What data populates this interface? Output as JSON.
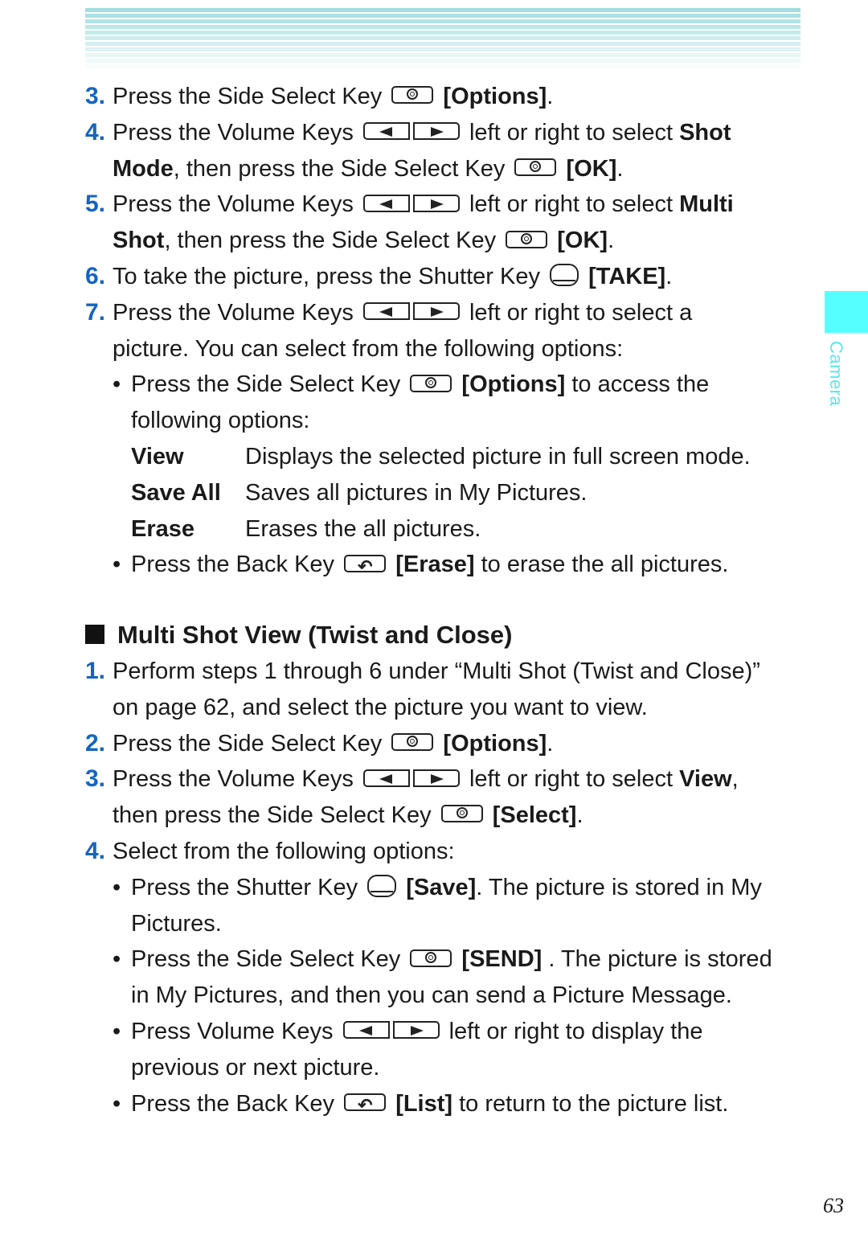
{
  "side_tab": {
    "label": "Camera",
    "color": "#55ffff"
  },
  "page_number": "63",
  "steps_top": [
    {
      "num": "3.",
      "parts": [
        "Press the Side Select Key",
        "[Options]",
        "."
      ]
    },
    {
      "num": "4.",
      "line1": [
        "Press the Volume Keys",
        "left or right to select",
        "Shot"
      ],
      "line2": [
        "Mode",
        ", then press the Side Select Key",
        "[OK]",
        "."
      ]
    },
    {
      "num": "5.",
      "line1": [
        "Press the Volume Keys",
        "left or right to select",
        "Multi"
      ],
      "line2": [
        "Shot",
        ", then press the Side Select Key",
        "[OK]",
        "."
      ]
    },
    {
      "num": "6.",
      "parts": [
        "To take the picture, press the Shutter Key",
        "[TAKE]",
        "."
      ]
    },
    {
      "num": "7.",
      "line1": [
        "Press the Volume Keys",
        "left or right to select a"
      ],
      "line2": [
        "picture. You can select from the following options:"
      ]
    }
  ],
  "bullet_options": {
    "parts": [
      "Press the Side Select Key",
      "[Options]",
      "to access the"
    ],
    "cont": "following options:"
  },
  "options": [
    {
      "key": "View",
      "desc": "Displays the selected picture in full screen mode."
    },
    {
      "key": "Save All",
      "desc": "Saves all pictures in My Pictures."
    },
    {
      "key": "Erase",
      "desc": "Erases the all pictures."
    }
  ],
  "bullet_erase": [
    "Press the Back Key",
    "[Erase]",
    "to erase the all pictures."
  ],
  "section_title": "Multi Shot View (Twist and Close)",
  "steps_bottom": [
    {
      "num": "1.",
      "line1": "Perform steps 1 through 6 under “Multi Shot (Twist and Close)”",
      "line2": "on page 62, and select the picture you want to view."
    },
    {
      "num": "2.",
      "parts": [
        "Press the Side Select Key",
        "[Options]",
        "."
      ]
    },
    {
      "num": "3.",
      "line1": [
        "Press the Volume Keys",
        "left or right to select",
        "View",
        ","
      ],
      "line2": [
        "then press the Side Select Key",
        "[Select]",
        "."
      ]
    },
    {
      "num": "4.",
      "text": "Select from the following options:"
    }
  ],
  "bullets_bottom": [
    {
      "parts": [
        "Press the Shutter Key",
        "[Save]",
        ". The picture is stored in My"
      ],
      "cont": "Pictures."
    },
    {
      "parts": [
        "Press the Side Select Key",
        "[SEND]",
        ". The picture is stored"
      ],
      "cont": "in My Pictures, and then you can send a Picture Message."
    },
    {
      "parts": [
        "Press Volume Keys",
        "left or right to display the"
      ],
      "cont": "previous or next picture."
    },
    {
      "parts": [
        "Press the Back Key",
        "[List]",
        "to return to the picture list."
      ]
    }
  ],
  "bullet_char": "•"
}
